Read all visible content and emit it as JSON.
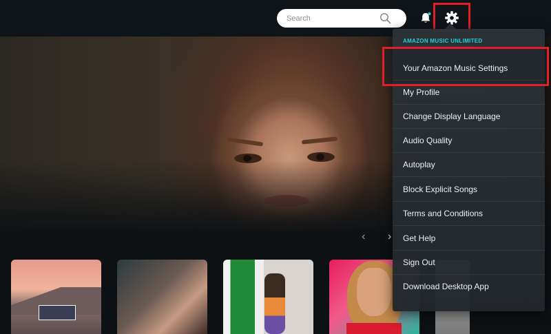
{
  "search": {
    "placeholder": "Search"
  },
  "menu": {
    "header": "AMAZON MUSIC UNLIMITED",
    "items": [
      {
        "label": "Your Amazon Music Settings"
      },
      {
        "label": "My Profile"
      },
      {
        "label": "Change Display Language"
      },
      {
        "label": "Audio Quality"
      },
      {
        "label": "Autoplay"
      },
      {
        "label": "Block Explicit Songs"
      },
      {
        "label": "Terms and Conditions"
      },
      {
        "label": "Get Help"
      },
      {
        "label": "Sign Out"
      },
      {
        "label": "Download Desktop App"
      }
    ]
  },
  "carousel": {
    "prev": "‹",
    "next": "›"
  },
  "colors": {
    "accent_highlight": "#e11f26",
    "menu_header": "#25d1da"
  },
  "icons": [
    "search-icon",
    "bell-icon",
    "gear-icon"
  ]
}
